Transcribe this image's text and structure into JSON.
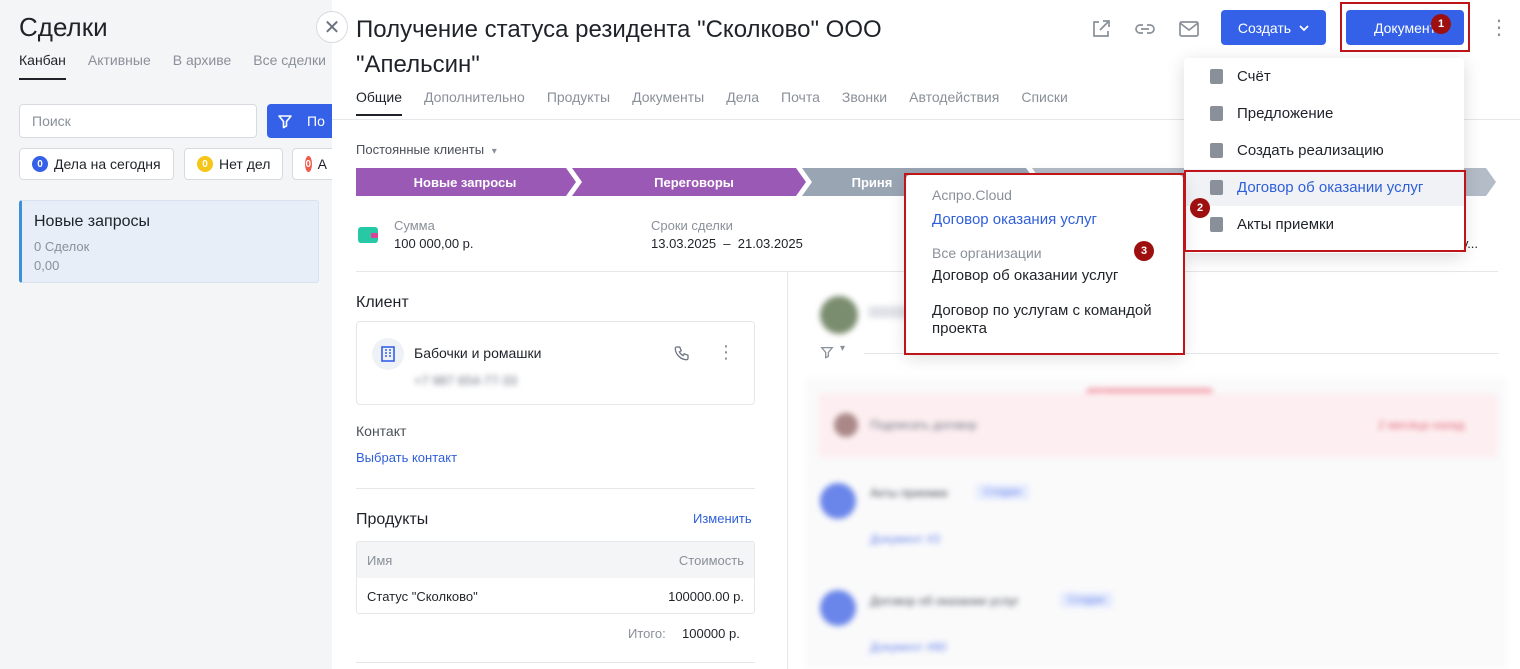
{
  "left": {
    "title": "Сделки",
    "tabs": [
      "Канбан",
      "Активные",
      "В архиве",
      "Все сделки"
    ],
    "search_placeholder": "Поиск",
    "filter_label": "По",
    "chips": [
      {
        "count": "0",
        "label": "Дела на сегодня",
        "color": "#3461e8"
      },
      {
        "count": "0",
        "label": "Нет дел",
        "color": "#f5c518"
      },
      {
        "count": "0",
        "label": "А",
        "color": "#f05a4a"
      }
    ],
    "column": {
      "title": "Новые запросы",
      "count": "0 Сделок",
      "sum": "0,00"
    }
  },
  "main": {
    "title": "Получение статуса резидента \"Сколково\" ООО \"Апельсин\"",
    "tabs": [
      "Общие",
      "Дополнительно",
      "Продукты",
      "Документы",
      "Дела",
      "Почта",
      "Звонки",
      "Автодействия",
      "Списки"
    ],
    "create_label": "Создать",
    "document_label": "Документ",
    "pipeline": "Постоянные клиенты",
    "stages": [
      {
        "label": "Новые запросы",
        "color": "#9b59b6"
      },
      {
        "label": "Переговоры",
        "color": "#9b59b6"
      },
      {
        "label": "Приня",
        "color": "#9aa5b4"
      }
    ],
    "sum_label": "Сумма",
    "sum_value": "100 000,00 р.",
    "dates_label": "Сроки сделки",
    "dates_value": "13.03.2025  –  21.03.2025",
    "truncated_right": "у...",
    "client_title": "Клиент",
    "client_name": "Бабочки и ромашки",
    "client_phone": "+7 987 654-77-33",
    "contact_title": "Контакт",
    "contact_link": "Выбрать контакт",
    "products_title": "Продукты",
    "products_edit": "Изменить",
    "products_table": {
      "headers": [
        "Имя",
        "Стоимость"
      ],
      "rows": [
        [
          "Статус \"Сколково\"",
          "100000.00 р."
        ]
      ]
    },
    "total_label": "Итого:",
    "total_value": "100000 р."
  },
  "doc_menu": {
    "items": [
      "Счёт",
      "Предложение",
      "Создать реализацию",
      "Договор об оказании услуг",
      "Акты приемки"
    ]
  },
  "submenu": {
    "group1": "Аспро.Cloud",
    "group1_item": "Договор оказания услуг",
    "group2": "Все организации",
    "group2_items": [
      "Договор об оказании услуг",
      "Договор по услугам с командой проекта"
    ]
  },
  "badges": [
    "1",
    "2",
    "3"
  ],
  "timeline_blurred": {
    "overdue": "Просроченные дела",
    "task": "Подписать договор",
    "task_date": "2 месяца назад",
    "item1": "Акты приемки",
    "item1_tag": "Создан",
    "item1_link": "Документ #3",
    "item2": "Договор об оказании услуг",
    "item2_tag": "Создан",
    "item2_link": "Документ #80"
  },
  "colors": {
    "accent": "#3461e8",
    "highlight_red": "#c0141b",
    "stage_purple": "#9b59b6"
  }
}
